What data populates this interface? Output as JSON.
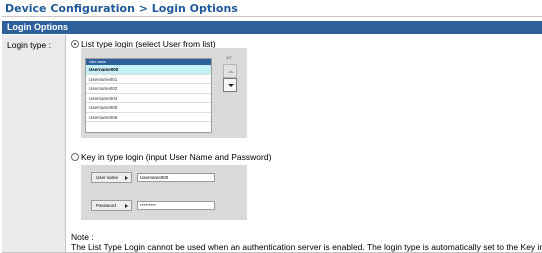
{
  "page_title": "Device Configuration > Login Options",
  "section_header": "Login Options",
  "login_type_label": "Login type :",
  "option_list": {
    "label": "List type login (select User from list)",
    "selected": true
  },
  "option_keyin": {
    "label": "Key in type login (input User Name and Password)",
    "selected": false
  },
  "list_preview": {
    "header": "User name",
    "page_indicator": "1/7",
    "rows": [
      "Username000",
      "Username001",
      "Username002",
      "Username004",
      "Username005",
      "Username006"
    ],
    "selected_index": 0
  },
  "keyin_preview": {
    "username_label": "User name",
    "username_value": "Username000",
    "password_label": "Password",
    "password_value": "*********"
  },
  "note": {
    "label": "Note :",
    "text": "The List Type Login cannot be used when an authentication server is enabled. The login type is automatically set to the Key in Type."
  },
  "colors": {
    "title_blue": "#1f5a98",
    "header_blue": "#2d5f9b",
    "selected_row": "#c6f0f7"
  }
}
